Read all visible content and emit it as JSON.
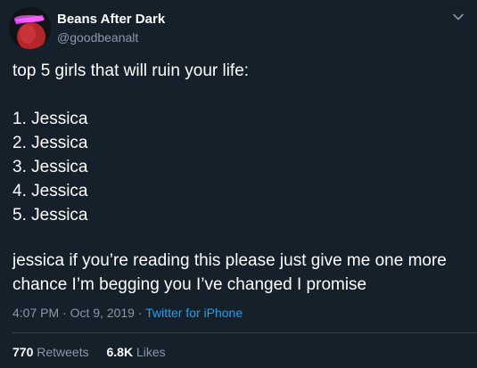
{
  "author": {
    "display_name": "Beans After Dark",
    "handle": "@goodbeanalt"
  },
  "tweet": {
    "intro": "top 5 girls that will ruin your life:",
    "list": [
      "1. Jessica",
      "2. Jessica",
      "3. Jessica",
      "4. Jessica",
      "5. Jessica"
    ],
    "closing": "jessica if you’re reading this please just give me one more chance I’m begging you I’ve changed I promise"
  },
  "meta": {
    "time": "4:07 PM",
    "separator": "·",
    "date": "Oct 9, 2019",
    "source": "Twitter for iPhone"
  },
  "stats": {
    "retweets_count": "770",
    "retweets_label": "Retweets",
    "likes_count": "6.8K",
    "likes_label": "Likes"
  },
  "icons": {
    "menu": "chevron-down-icon",
    "avatar": "bean-character-avatar"
  },
  "colors": {
    "background": "#15202b",
    "secondary_text": "#8899a6",
    "link": "#1da1f2",
    "divider": "#38444d"
  }
}
